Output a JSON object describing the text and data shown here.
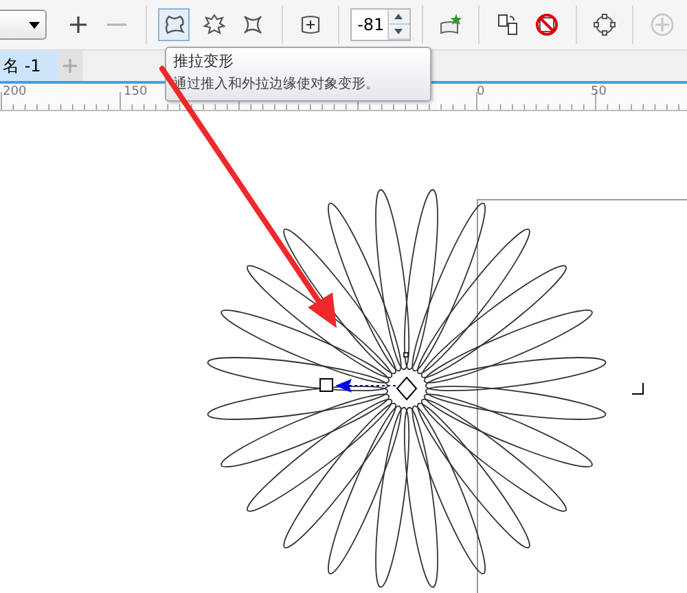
{
  "toolbar": {
    "items": [
      {
        "kind": "dropdown"
      },
      {
        "kind": "button",
        "selected": false,
        "disabled": false
      },
      {
        "kind": "button",
        "selected": false,
        "disabled": true
      },
      {
        "kind": "separator"
      },
      {
        "kind": "button",
        "selected": true,
        "disabled": false
      },
      {
        "kind": "button",
        "selected": false,
        "disabled": false
      },
      {
        "kind": "button",
        "selected": false,
        "disabled": false
      },
      {
        "kind": "separator"
      },
      {
        "kind": "button",
        "selected": false,
        "disabled": false
      },
      {
        "kind": "separator"
      },
      {
        "kind": "field",
        "value": "-81"
      },
      {
        "kind": "separator"
      },
      {
        "kind": "button",
        "selected": false,
        "disabled": false
      },
      {
        "kind": "separator"
      },
      {
        "kind": "button",
        "selected": false,
        "disabled": false
      },
      {
        "kind": "button",
        "selected": false,
        "disabled": false
      },
      {
        "kind": "separator"
      },
      {
        "kind": "button",
        "selected": false,
        "disabled": false
      },
      {
        "kind": "separator"
      },
      {
        "kind": "button",
        "selected": false,
        "disabled": true
      }
    ]
  },
  "tooltip": {
    "title": "推拉变形",
    "description": "通过推入和外拉边缘使对象变形。"
  },
  "document_tabs": [
    {
      "label": "名 -1",
      "selected": true
    }
  ],
  "ruler": {
    "labels": [
      "200",
      "150",
      "0",
      "50"
    ]
  }
}
